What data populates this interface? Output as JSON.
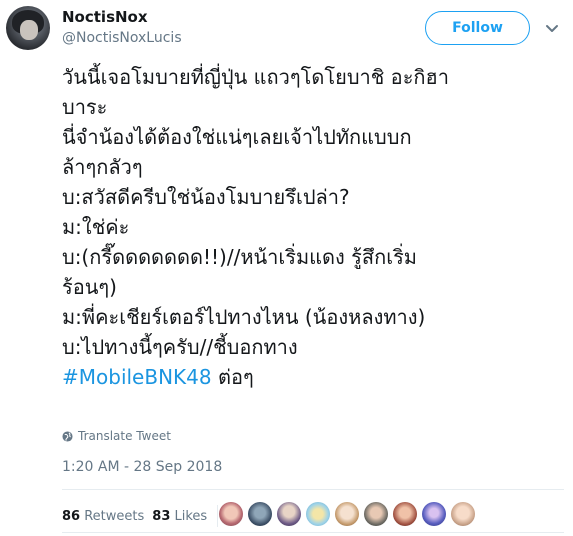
{
  "user": {
    "display_name": "NoctisNox",
    "handle": "@NoctisNoxLucis"
  },
  "follow_label": "Follow",
  "tweet_lines": [
    "วันนี้เจอโมบายที่ญี่ปุ่น แถวๆโดโยบาชิ อะกิฮา",
    "บาระ",
    "นี่จำน้องได้ต้องใช่แน่ๆเลยเจ้าไปทักแบบก",
    "ล้าๆกลัวๆ",
    "บ:สวัสดีครีบใช่น้องโมบายรึเปล่า?",
    "ม:ใช่ค่ะ",
    "บ:(กรี๊ดดดดดดด!!)//หน้าเริ่มแดง รู้สึกเริ่ม",
    "ร้อนๆ)",
    "ม:พี่คะเชียร์เตอร์ไปทางไหน (น้องหลงทาง)",
    "บ:ไปทางนี้ๆครับ//ชี้บอกทาง"
  ],
  "hashtag": "#MobileBNK48",
  "hashtag_suffix": " ต่อๆ",
  "translate_label": "Translate Tweet",
  "timestamp": "1:20 AM - 28 Sep 2018",
  "stats": {
    "retweets_count": "86",
    "retweets_label": "Retweets",
    "likes_count": "83",
    "likes_label": "Likes"
  },
  "colors": {
    "brand_blue": "#1da1f2",
    "hashtag_blue": "#1b95e0",
    "secondary_text": "#657786"
  },
  "icons": [
    "globe-icon",
    "chevron-down-icon"
  ]
}
